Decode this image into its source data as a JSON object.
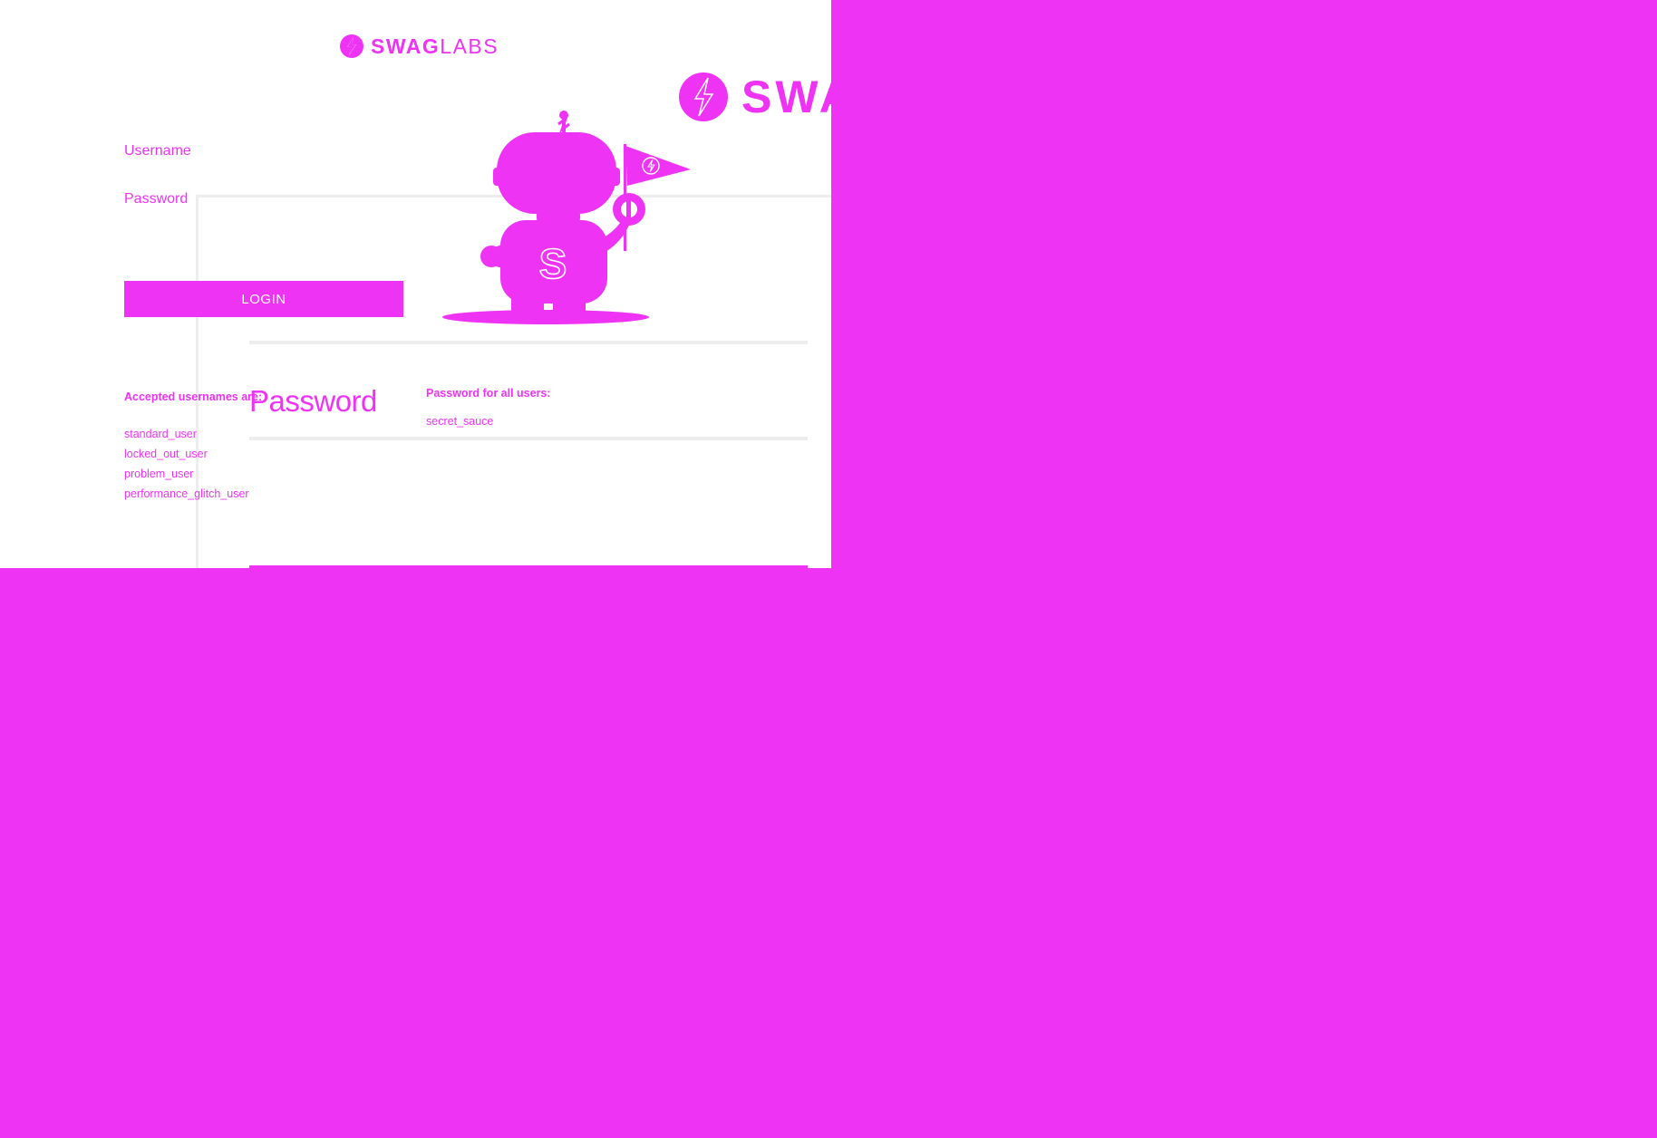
{
  "brand": {
    "name_bold": "SWAG",
    "name_light": "LABS",
    "big_fragment": "SWA"
  },
  "form": {
    "username_label": "Username",
    "password_label": "Password",
    "login_label": "LOGIN"
  },
  "credentials": {
    "usernames_heading": "Accepted usernames are:",
    "usernames": [
      "standard_user",
      "locked_out_user",
      "problem_user",
      "performance_glitch_user"
    ],
    "password_heading": "Password for all users:",
    "password_value": "secret_sauce",
    "password_large_label": "Password"
  },
  "colors": {
    "background": "#ee33f5",
    "panel": "#ffffff",
    "accent": "#ee33f5",
    "divider": "#ededed"
  },
  "icons": {
    "logo": "swaglabs-bolt-icon",
    "mascot": "swag-bot-illustration"
  }
}
